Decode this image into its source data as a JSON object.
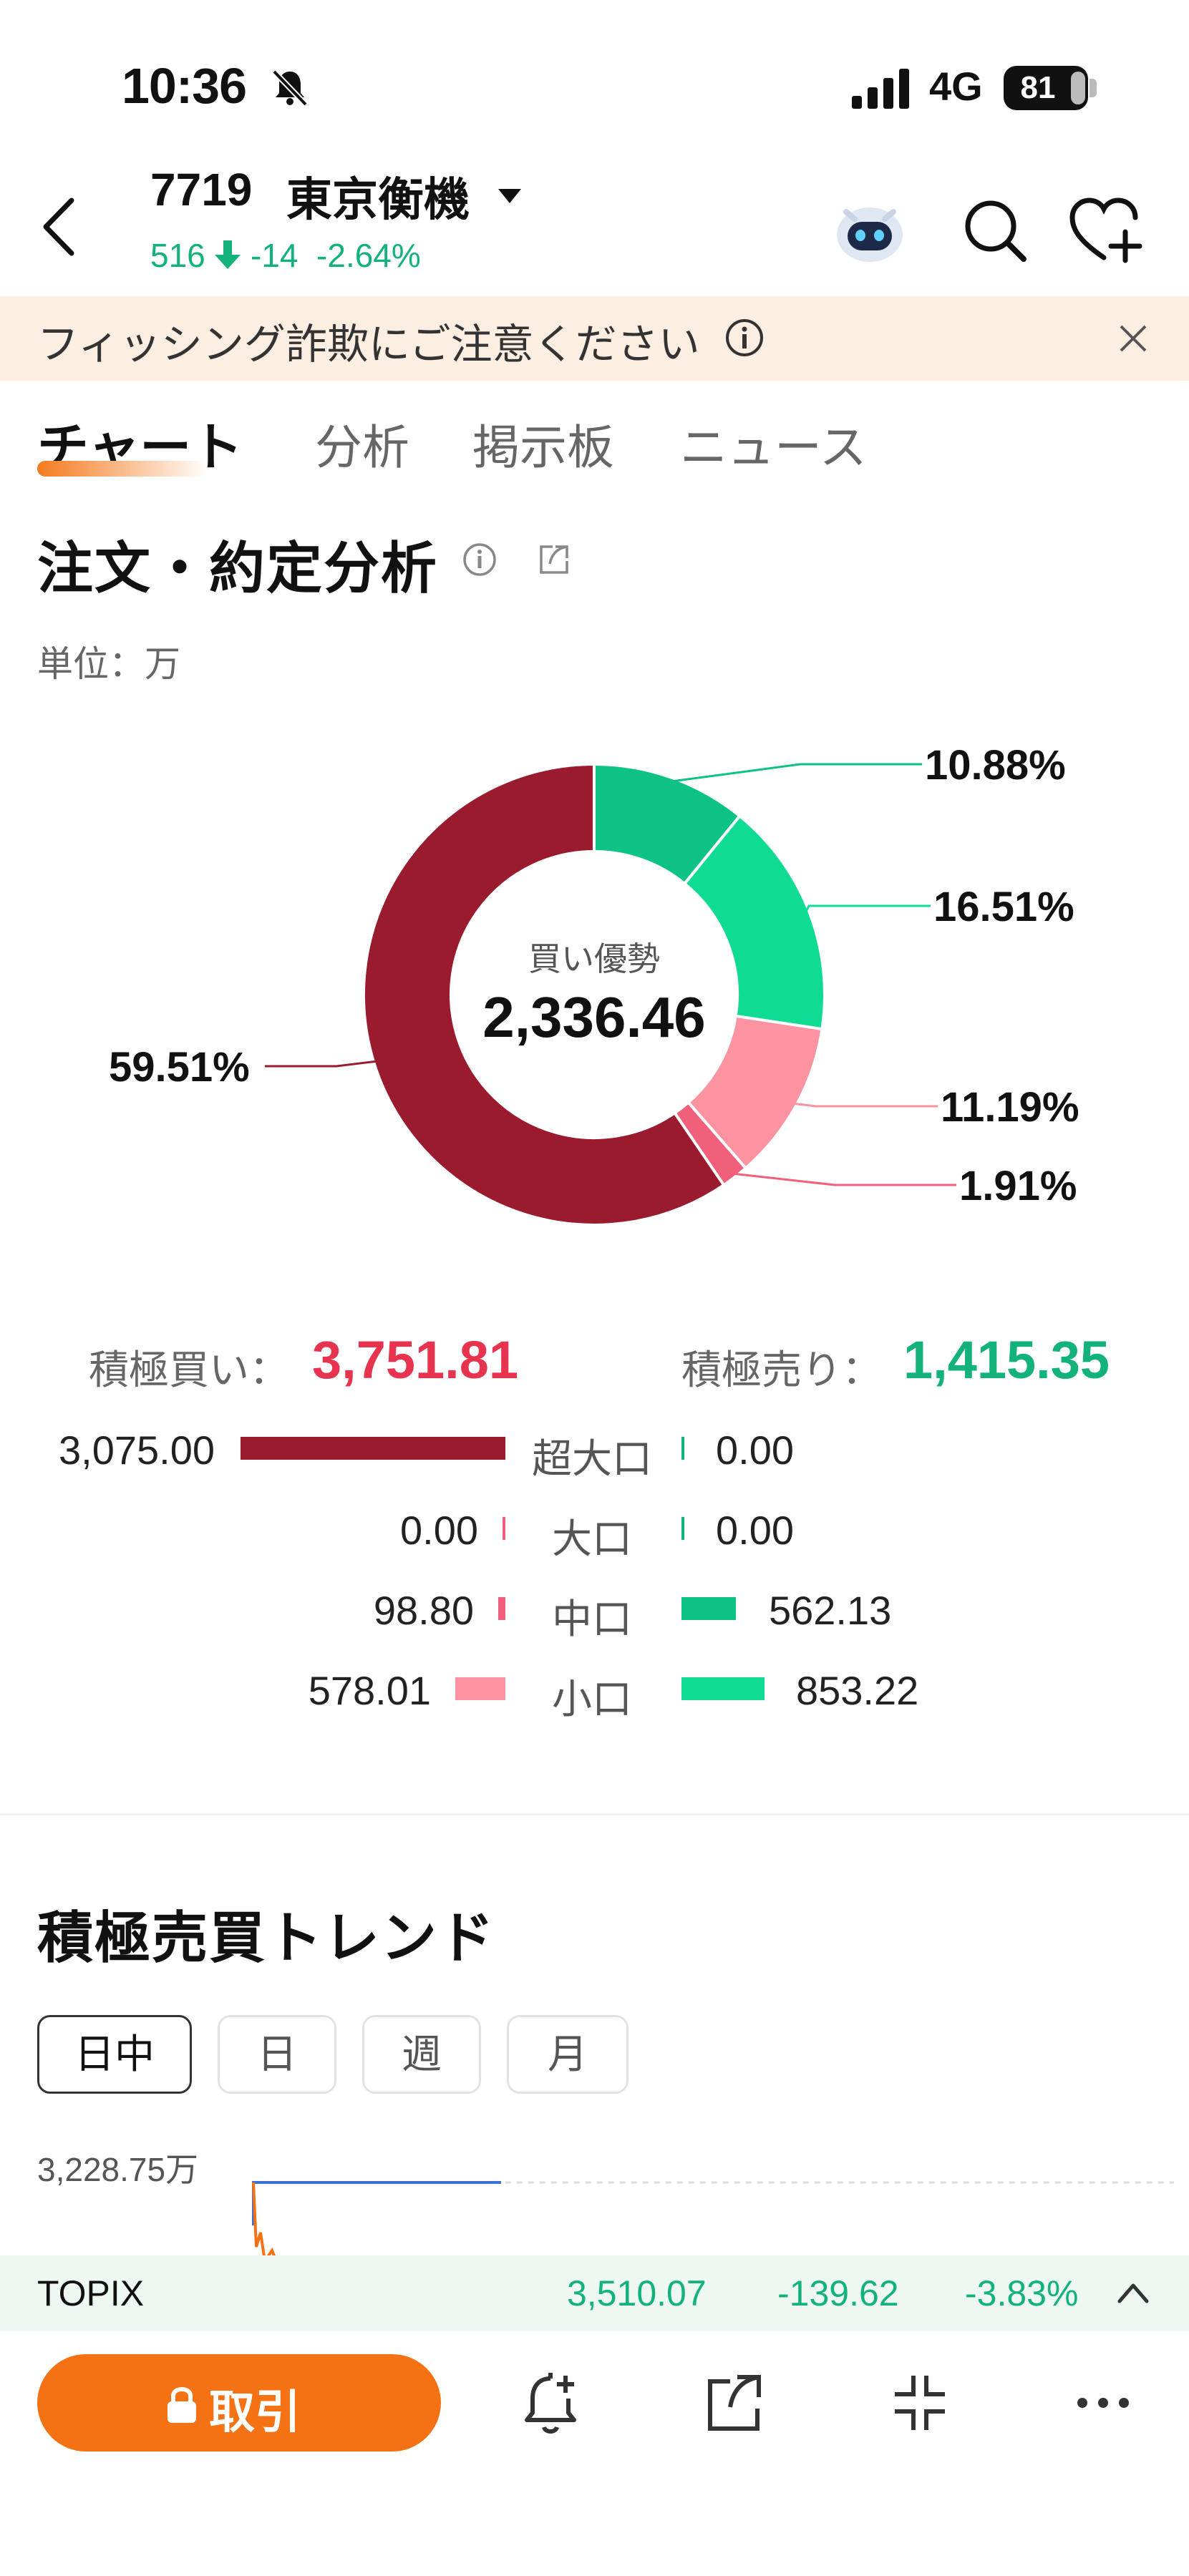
{
  "status_bar": {
    "time": "10:36",
    "network": "4G",
    "battery": "81"
  },
  "header": {
    "code": "7719",
    "name": "東京衡機",
    "price": "516",
    "change": "-14",
    "change_pct": "-2.64%"
  },
  "banner": {
    "text": "フィッシング詐欺にご注意ください"
  },
  "tabs": [
    {
      "label": "チャート",
      "active": true
    },
    {
      "label": "分析",
      "active": false
    },
    {
      "label": "掲示板",
      "active": false
    },
    {
      "label": "ニュース",
      "active": false
    }
  ],
  "analysis": {
    "title": "注文・約定分析",
    "unit": "単位：万",
    "center_label": "買い優勢",
    "center_value": "2,336.46",
    "buy_label": "積極買い：",
    "buy_value": "3,751.81",
    "sell_label": "積極売り：",
    "sell_value": "1,415.35",
    "rows": [
      {
        "cat": "超大口",
        "buy": "3,075.00",
        "sell": "0.00"
      },
      {
        "cat": "大口",
        "buy": "0.00",
        "sell": "0.00"
      },
      {
        "cat": "中口",
        "buy": "98.80",
        "sell": "562.13"
      },
      {
        "cat": "小口",
        "buy": "578.01",
        "sell": "853.22"
      }
    ]
  },
  "chart_data": {
    "type": "pie",
    "donut": true,
    "labels_text": [
      "10.88%",
      "16.51%",
      "11.19%",
      "1.91%",
      "59.51%"
    ],
    "values": [
      10.88,
      16.51,
      11.19,
      1.91,
      59.51
    ],
    "colors": [
      "#0dc285",
      "#0fdb92",
      "#fd92a0",
      "#f0607a",
      "#9b1b2e"
    ]
  },
  "trend": {
    "title": "積極売買トレンド",
    "chips": [
      {
        "label": "日中",
        "active": true
      },
      {
        "label": "日",
        "active": false
      },
      {
        "label": "週",
        "active": false
      },
      {
        "label": "月",
        "active": false
      }
    ],
    "y_label": "3,228.75万"
  },
  "topix": {
    "name": "TOPIX",
    "value": "3,510.07",
    "change": "-139.62",
    "change_pct": "-3.83%"
  },
  "bottom": {
    "trade_label": "取引"
  },
  "colors": {
    "accent": "#f47214",
    "up_red": "#e8334f",
    "down_green": "#12b27a"
  }
}
